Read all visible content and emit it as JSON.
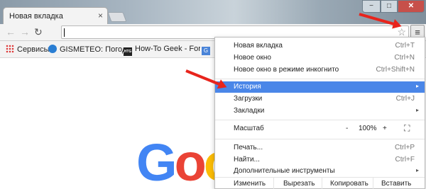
{
  "window": {
    "tab_title": "Новая вкладка",
    "tab_close": "×",
    "min": "−",
    "max": "□",
    "close": "✕"
  },
  "toolbar": {
    "back": "←",
    "forward": "→",
    "reload": "↻",
    "address_value": "",
    "star": "☆",
    "menu": "≡"
  },
  "bookmarks": [
    {
      "label": "Сервисы",
      "icon": "apps-grid-icon"
    },
    {
      "label": "GISMETEO: Погода в",
      "icon": "gismeteo-icon"
    },
    {
      "label": "How-To Geek - For Ge",
      "icon": "htg-icon",
      "badge": "HTG"
    },
    {
      "label": "",
      "icon": "google-translate-icon",
      "badge": "G"
    }
  ],
  "logo": {
    "letters": [
      "G",
      "o",
      "o"
    ],
    "colors": [
      "#4285F4",
      "#EA4335",
      "#FBBC05"
    ]
  },
  "menu": {
    "items": [
      {
        "label": "Новая вкладка",
        "shortcut": "Ctrl+T"
      },
      {
        "label": "Новое окно",
        "shortcut": "Ctrl+N"
      },
      {
        "label": "Новое окно в режиме инкогнито",
        "shortcut": "Ctrl+Shift+N"
      },
      {
        "label": "История",
        "shortcut": "",
        "submenu": true,
        "active": true
      },
      {
        "label": "Загрузки",
        "shortcut": "Ctrl+J"
      },
      {
        "label": "Закладки",
        "shortcut": "",
        "submenu": true
      },
      {
        "label": "Печать...",
        "shortcut": "Ctrl+P"
      },
      {
        "label": "Найти...",
        "shortcut": "Ctrl+F"
      },
      {
        "label": "Дополнительные инструменты",
        "shortcut": "",
        "submenu": true
      }
    ],
    "zoom": {
      "label": "Масштаб",
      "minus": "-",
      "value": "100%",
      "plus": "+",
      "fullscreen": "⛶"
    },
    "edit": {
      "cut_partial": "Изменить",
      "cut": "Вырезать",
      "copy": "Копировать",
      "paste": "Вставить"
    },
    "submenu_arrow": "▸"
  },
  "colors": {
    "highlight": "#4a86e8",
    "arrow": "#e8241c"
  }
}
